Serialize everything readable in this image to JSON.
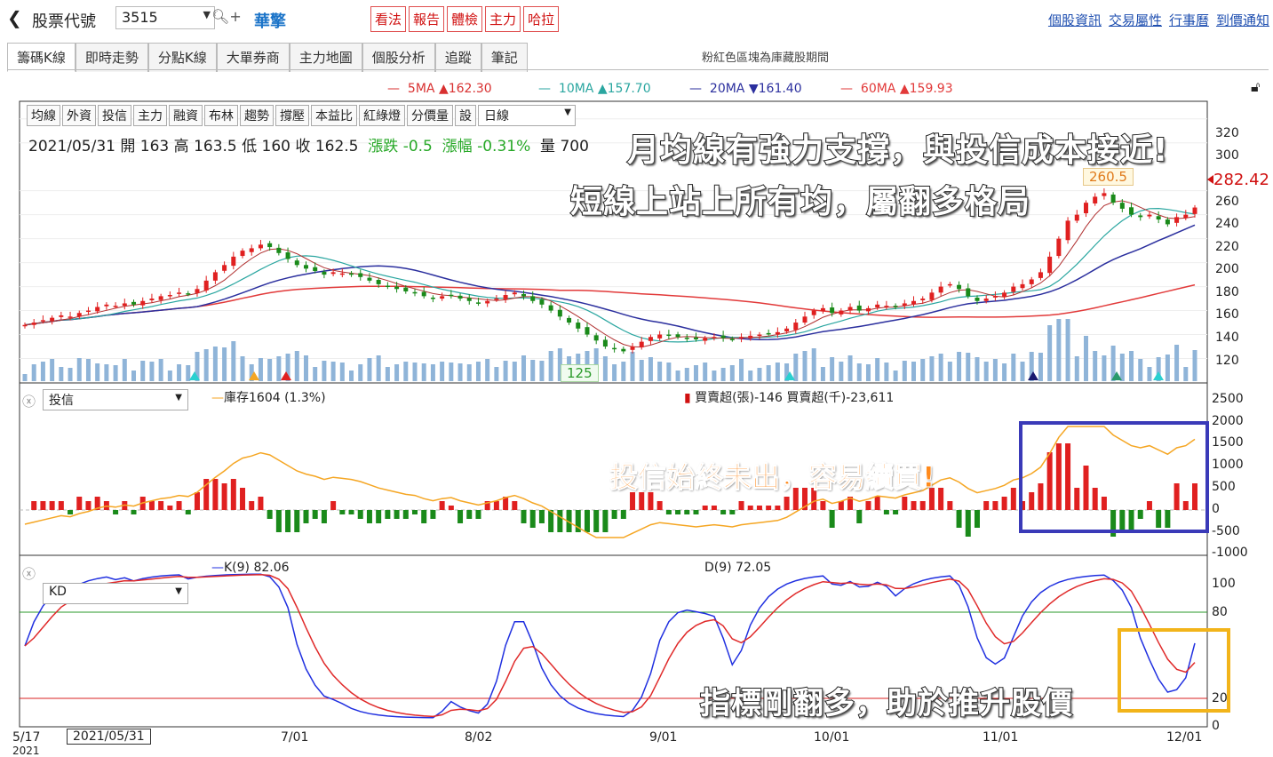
{
  "topbar": {
    "back_icon": "chevron-left-icon",
    "stock_label": "股票代號",
    "code": "3515",
    "name": "華擎",
    "buttons": [
      "看法",
      "報告",
      "體檢",
      "主力",
      "哈拉"
    ],
    "links": [
      "個股資訊",
      "交易屬性",
      "行事曆",
      "到價通知"
    ]
  },
  "tabs": [
    "籌碼K線",
    "即時走勢",
    "分點K線",
    "大單券商",
    "主力地圖",
    "個股分析",
    "追蹤",
    "筆記"
  ],
  "tab_note": "粉紅色區塊為庫藏股期間",
  "ma_legend": [
    {
      "label": "5MA",
      "arrow": "▲",
      "value": "162.30",
      "color": "#d83030"
    },
    {
      "label": "10MA",
      "arrow": "▲",
      "value": "157.70",
      "color": "#2aa6a0"
    },
    {
      "label": "20MA",
      "arrow": "▼",
      "value": "161.40",
      "color": "#2b2f9e"
    },
    {
      "label": "60MA",
      "arrow": "▲",
      "value": "159.93",
      "color": "#e23a3a"
    }
  ],
  "toolbar": {
    "buttons": [
      "均線",
      "外資",
      "投信",
      "主力",
      "融資",
      "布林",
      "趨勢",
      "撐壓",
      "本益比",
      "紅綠燈",
      "分價量",
      "設"
    ],
    "period": "日線"
  },
  "ohlc": {
    "date": "2021/05/31",
    "open_label": "開",
    "open": "163",
    "high_label": "高",
    "high": "163.5",
    "low_label": "低",
    "low": "160",
    "close_label": "收",
    "close": "162.5",
    "chg_label": "漲跌",
    "chg": "-0.5",
    "pct_label": "漲幅",
    "pct": "-0.31%",
    "vol_label": "量",
    "vol": "700"
  },
  "annotations": {
    "title1": "月均線有強力支撐，與投信成本接近!",
    "title2": "短線上站上所有均，屬翻多格局",
    "inv_note": "投信始終未出，容易續買!",
    "kd_note": "指標剛翻多，助於推升股價"
  },
  "price_labels": {
    "high_tag": "260.5",
    "low_tag": "125",
    "last_price": "282.42"
  },
  "price_axis": [
    "320",
    "300",
    "282.42",
    "260",
    "240",
    "220",
    "200",
    "180",
    "160",
    "140",
    "120"
  ],
  "inv_panel": {
    "selector": "投信",
    "inventory": "庫存1604 (1.3%)",
    "net": "買賣超(張)-146 買賣超(千)-23,611",
    "axis": [
      "2500",
      "2000",
      "1500",
      "1000",
      "500",
      "0",
      "-500",
      "-1000"
    ]
  },
  "kd_panel": {
    "selector": "KD",
    "k": "K(9) 82.06",
    "d": "D(9) 72.05",
    "axis": [
      "100",
      "80",
      "20",
      "0"
    ]
  },
  "x_axis": {
    "labels": [
      "5/17",
      "7/01",
      "8/02",
      "9/01",
      "10/01",
      "11/01",
      "12/01"
    ],
    "year": "2021",
    "cursor_date": "2021/05/31"
  },
  "chart_data": {
    "type": "candlestick",
    "title": "",
    "ylim": [
      110,
      325
    ],
    "close": [
      148,
      150,
      152,
      154,
      156,
      155,
      158,
      160,
      163,
      165,
      164,
      166,
      165,
      168,
      170,
      172,
      173,
      175,
      174,
      178,
      185,
      192,
      198,
      205,
      210,
      212,
      215,
      213,
      208,
      203,
      198,
      195,
      193,
      190,
      192,
      191,
      190,
      188,
      185,
      182,
      180,
      178,
      176,
      175,
      172,
      170,
      172,
      173,
      170,
      168,
      166,
      168,
      170,
      173,
      175,
      172,
      168,
      165,
      160,
      155,
      150,
      145,
      140,
      135,
      130,
      128,
      126,
      130,
      134,
      138,
      140,
      139,
      138,
      137,
      136,
      137,
      138,
      137,
      136,
      138,
      139,
      140,
      141,
      142,
      145,
      150,
      155,
      160,
      162,
      158,
      160,
      163,
      160,
      162,
      165,
      164,
      163,
      166,
      168,
      170,
      175,
      180,
      182,
      178,
      172,
      168,
      170,
      172,
      175,
      180,
      182,
      186,
      192,
      205,
      220,
      235,
      240,
      250,
      255,
      258,
      250,
      245,
      240,
      238,
      240,
      236,
      232,
      238,
      240,
      246
    ]
  }
}
